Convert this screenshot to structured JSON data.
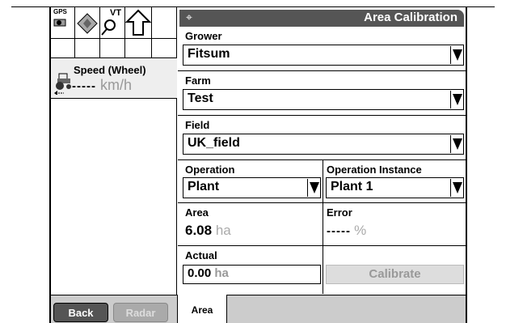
{
  "header": {
    "title": "Area Calibration"
  },
  "status_icons": {
    "gps_label": "GPS",
    "vt_label": "VT"
  },
  "speed": {
    "label": "Speed (Wheel)",
    "value": "-----",
    "unit": "km/h"
  },
  "form": {
    "grower": {
      "label": "Grower",
      "value": "Fitsum"
    },
    "farm": {
      "label": "Farm",
      "value": "Test"
    },
    "field": {
      "label": "Field",
      "value": "UK_field"
    },
    "operation": {
      "label": "Operation",
      "value": "Plant"
    },
    "operation_instance": {
      "label": "Operation Instance",
      "value": "Plant 1"
    },
    "area": {
      "label": "Area",
      "value": "6.08",
      "unit": "ha"
    },
    "error": {
      "label": "Error",
      "value": "-----",
      "unit": "%"
    },
    "actual": {
      "label": "Actual",
      "value": "0.00",
      "unit": "ha"
    },
    "calibrate_label": "Calibrate"
  },
  "softkeys": {
    "back": "Back",
    "radar": "Radar"
  },
  "tabs": [
    {
      "label": "Area"
    }
  ]
}
